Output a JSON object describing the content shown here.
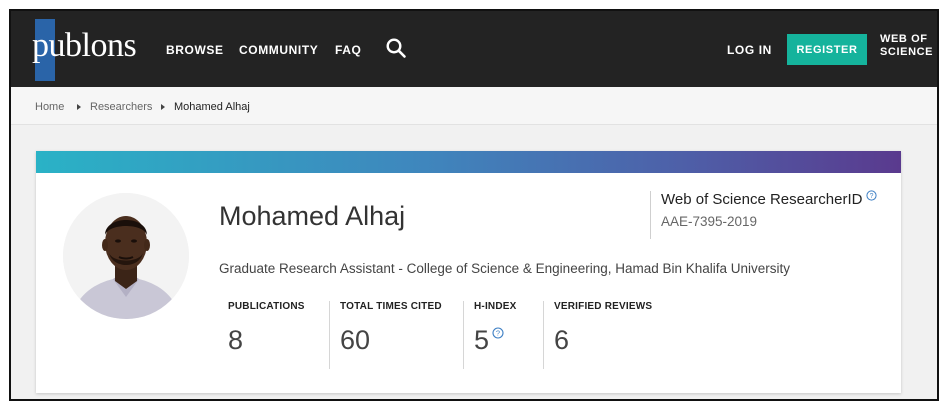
{
  "nav": {
    "logo_text": "publons",
    "items": [
      "BROWSE",
      "COMMUNITY",
      "FAQ"
    ],
    "login": "LOG IN",
    "register": "REGISTER",
    "wos_line1": "WEB OF",
    "wos_line2": "SCIENCE",
    "register_color": "#15b39c"
  },
  "breadcrumb": [
    "Home",
    "Researchers",
    "Mohamed Alhaj"
  ],
  "profile": {
    "name": "Mohamed Alhaj",
    "affiliation": "Graduate Research Assistant - College of Science & Engineering, Hamad Bin Khalifa University",
    "researcher_id_label": "Web of Science ResearcherID",
    "researcher_id": "AAE-7395-2019",
    "avatar_icon": "profile-photo"
  },
  "metrics": [
    {
      "label": "PUBLICATIONS",
      "value": "8"
    },
    {
      "label": "TOTAL TIMES CITED",
      "value": "60"
    },
    {
      "label": "H-INDEX",
      "value": "5"
    },
    {
      "label": "VERIFIED REVIEWS",
      "value": "6"
    }
  ]
}
